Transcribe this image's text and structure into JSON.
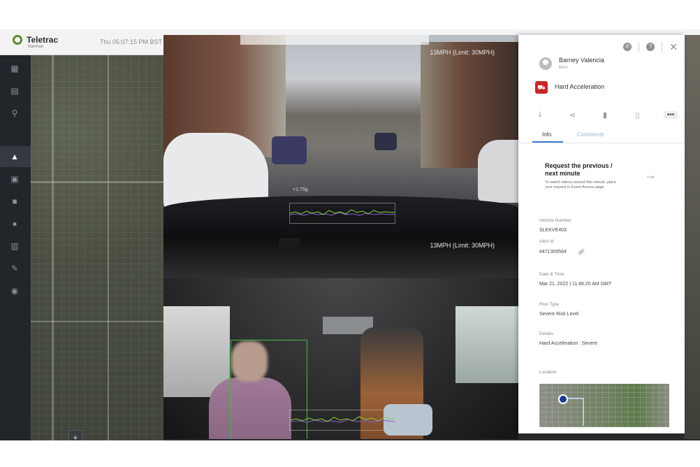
{
  "app": {
    "logo": "Teletrac",
    "logo_sub": "Navman",
    "datetime": "Thu 05:07:15 PM BST"
  },
  "rail": {
    "icons": [
      "dashboard-icon",
      "document-icon",
      "route-icon",
      "alert-icon",
      "calendar-icon",
      "video-icon",
      "driver-icon",
      "report-icon",
      "wrench-icon",
      "location-icon"
    ],
    "active": "alert-icon"
  },
  "map": {
    "zoom_in": "+",
    "zoom_out": "−"
  },
  "video": {
    "road_speed": "13MPH (Limit: 30MPH)",
    "cabin_speed": "13MPH (Limit: 30MPH)",
    "road_graph_label": "+1.75g",
    "colors": {
      "graph_green": "#8ad13a",
      "graph_purple": "#8a5bd6",
      "face_box": "#3dc03d"
    }
  },
  "panel": {
    "user_name": "Barney Valencia",
    "user_sub": "Bern",
    "event_title": "Hard Acceleration",
    "tabs": {
      "info": "Info",
      "comments": "Comments"
    },
    "request": {
      "title_line1": "Request the previous /",
      "title_line2": "next minute",
      "sub_line1": "To watch videos around this minute, place",
      "sub_line2": "your request in Event Access page"
    },
    "fields": {
      "vehicle_number_label": "Vehicle Number",
      "vehicle_number": "SLEKVE403",
      "alert_id_label": "Alert Id",
      "alert_id": "#471309564",
      "datetime_label": "Date & Time",
      "datetime": "Mar 21, 2022 | 11:48:20 AM GMT",
      "risk_type_label": "Risk Type",
      "risk_type": "Severe Risk Level",
      "details_label": "Details",
      "details": "Hard Acceleration : Severe",
      "location_label": "Location"
    },
    "colors": {
      "accent": "#3b7bd1",
      "event_red": "#c62828"
    }
  }
}
